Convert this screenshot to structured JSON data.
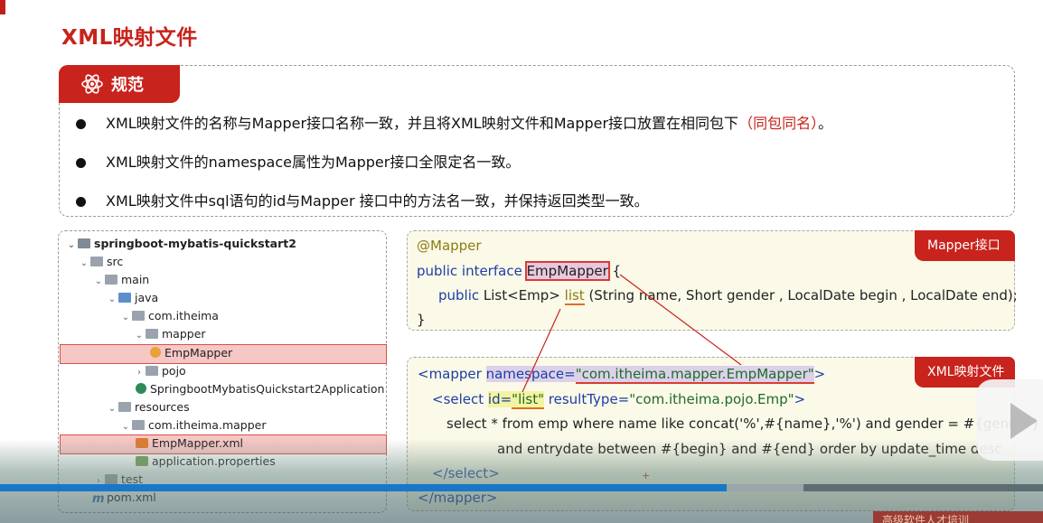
{
  "title": "XML映射文件",
  "rules": {
    "tab_label": "规范",
    "items": [
      {
        "text": "XML映射文件的名称与Mapper接口名称一致，并且将XML映射文件和Mapper接口放置在相同包下",
        "highlight": "（同包同名）",
        "tail": "。"
      },
      {
        "text": "XML映射文件的namespace属性为Mapper接口全限定名一致。",
        "highlight": "",
        "tail": ""
      },
      {
        "text": "XML映射文件中sql语句的id与Mapper 接口中的方法名一致，并保持返回类型一致。",
        "highlight": "",
        "tail": ""
      }
    ]
  },
  "tree": [
    {
      "label": "springboot-mybatis-quickstart2",
      "icon": "module-icon",
      "expanded": true,
      "bold": true
    },
    {
      "label": "src",
      "icon": "folder-icon",
      "expanded": true
    },
    {
      "label": "main",
      "icon": "folder-icon",
      "expanded": true
    },
    {
      "label": "java",
      "icon": "folder-icon",
      "expanded": true
    },
    {
      "label": "com.itheima",
      "icon": "package-icon",
      "expanded": true
    },
    {
      "label": "mapper",
      "icon": "package-icon",
      "expanded": true
    },
    {
      "label": "EmpMapper",
      "icon": "interface-icon",
      "highlighted": true
    },
    {
      "label": "pojo",
      "icon": "package-icon",
      "expanded": false
    },
    {
      "label": "SpringbootMybatisQuickstart2Application",
      "icon": "spring-class-icon"
    },
    {
      "label": "resources",
      "icon": "folder-icon",
      "expanded": true
    },
    {
      "label": "com.itheima.mapper",
      "icon": "folder-icon",
      "expanded": true
    },
    {
      "label": "EmpMapper.xml",
      "icon": "xml-file-icon",
      "highlighted": true
    },
    {
      "label": "application.properties",
      "icon": "properties-file-icon"
    },
    {
      "label": "test",
      "icon": "folder-icon",
      "expanded": false
    },
    {
      "label": "pom.xml",
      "icon": "maven-icon"
    }
  ],
  "mapper_code": {
    "tag": "Mapper接口",
    "annotation": "@Mapper",
    "line2_kw": "public interface ",
    "line2_name": "EmpMapper",
    "line2_brace": " {",
    "line3_kw": "public ",
    "line3_type": "List<Emp> ",
    "line3_method": "list",
    "line3_params": " (String name, Short gender , LocalDate begin , LocalDate end);",
    "line4": "}"
  },
  "xml_code": {
    "tag": "XML映射文件",
    "l1_open": "<mapper ",
    "l1_attr": "namespace=",
    "l1_val": "\"com.itheima.mapper.EmpMapper\"",
    "l1_close": ">",
    "l2_open": "<select ",
    "l2_id_attr": "id=",
    "l2_id_val": "\"list\"",
    "l2_rt_attr": " resultType=",
    "l2_rt_val": "\"com.itheima.pojo.Emp\"",
    "l2_close": ">",
    "l3": "select * from emp where name like concat('%',#{name},'%') and gender = #{gender}",
    "l4": "and entrydate between #{begin} and #{end} order by update_time desc",
    "l5": "</select>",
    "l6": "</mapper>"
  },
  "player": {
    "progress_fraction": 0.697,
    "buffer_fraction": 0.073,
    "caption": "高级软件人才培训"
  },
  "colors": {
    "accent_red": "#c8231c",
    "progress_blue": "#1877c8",
    "code_bg": "#fbf9e8"
  }
}
